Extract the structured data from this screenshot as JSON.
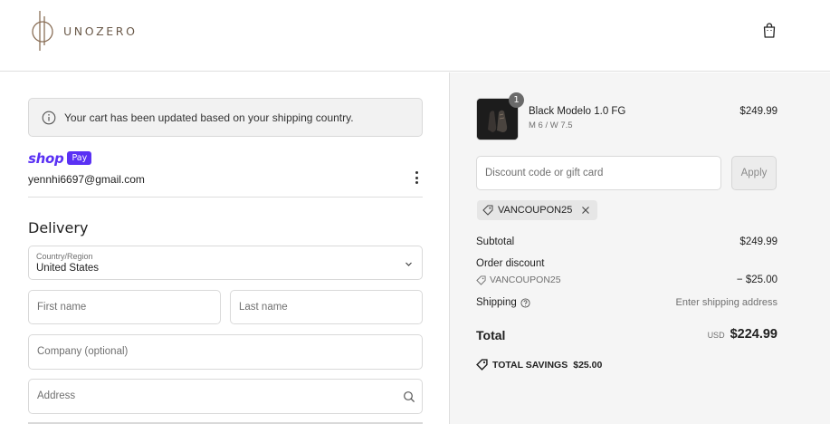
{
  "brand": {
    "name": "UNOZERO",
    "logo_icon": "unozero-logo-icon",
    "cart_icon": "shopping-bag-icon"
  },
  "notice": {
    "icon": "info-icon",
    "text": "Your cart has been updated based on your shipping country."
  },
  "shop_pay": {
    "word": "shop",
    "badge": "Pay"
  },
  "account": {
    "email": "yennhi6697@gmail.com",
    "menu_icon": "more-vertical-icon"
  },
  "delivery": {
    "title": "Delivery",
    "country": {
      "label": "Country/Region",
      "value": "United States"
    },
    "first_name": {
      "placeholder": "First name"
    },
    "last_name": {
      "placeholder": "Last name"
    },
    "company": {
      "placeholder": "Company (optional)"
    },
    "address": {
      "placeholder": "Address",
      "icon": "search-icon"
    }
  },
  "summary": {
    "product": {
      "name": "Black Modelo 1.0 FG",
      "variant": "M 6 / W 7.5",
      "price": "$249.99",
      "quantity": "1"
    },
    "discount": {
      "placeholder": "Discount code or gift card",
      "apply_label": "Apply"
    },
    "coupon": {
      "code": "VANCOUPON25"
    },
    "subtotal_label": "Subtotal",
    "subtotal_value": "$249.99",
    "order_discount_label": "Order discount",
    "order_discount_code": "VANCOUPON25",
    "order_discount_value": "− $25.00",
    "shipping_label": "Shipping",
    "shipping_value": "Enter shipping address",
    "total_label": "Total",
    "total_currency": "USD",
    "total_value": "$224.99",
    "savings_label": "TOTAL SAVINGS",
    "savings_value": "$25.00"
  },
  "colors": {
    "shop_pay_purple": "#5a31f4",
    "summary_bg": "#f5f5f5",
    "brand_brown": "#6b5a4a"
  }
}
